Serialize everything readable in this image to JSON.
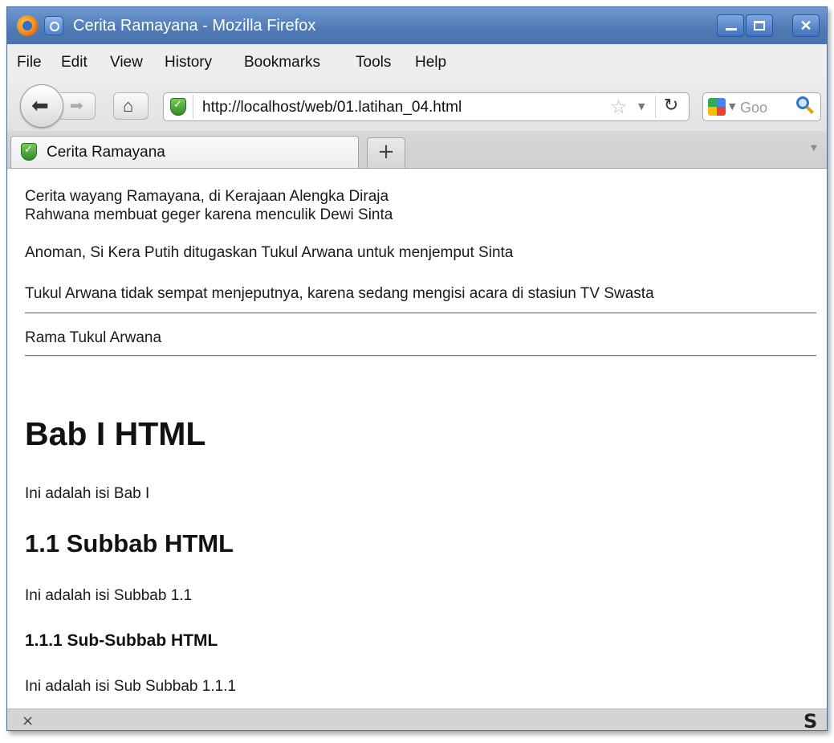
{
  "window": {
    "title": "Cerita Ramayana - Mozilla Firefox"
  },
  "menubar": {
    "items": [
      {
        "label": "File"
      },
      {
        "label": "Edit"
      },
      {
        "label": "View"
      },
      {
        "label": "History"
      },
      {
        "label": "Bookmarks"
      },
      {
        "label": "Tools"
      },
      {
        "label": "Help"
      }
    ]
  },
  "navbar": {
    "url": "http://localhost/web/01.latihan_04.html",
    "search_placeholder": "Goo"
  },
  "tabs": [
    {
      "label": "Cerita Ramayana",
      "active": true
    }
  ],
  "content": {
    "para1_line1": "Cerita wayang Ramayana, di Kerajaan Alengka Diraja",
    "para1_line2": "Rahwana membuat geger karena menculik Dewi Sinta",
    "para2": "Anoman, Si Kera Putih ditugaskan Tukul Arwana untuk menjemput Sinta",
    "para3": "Tukul Arwana tidak sempat menjeputnya, karena sedang mengisi acara di stasiun TV Swasta",
    "para4": "Rama Tukul Arwana",
    "h1": "Bab I HTML",
    "h1_body": "Ini adalah isi Bab I",
    "h2": "1.1 Subbab HTML",
    "h2_body": "Ini adalah isi Subbab 1.1",
    "h3": "1.1.1 Sub-Subbab HTML",
    "h3_body": "Ini adalah isi Sub Subbab 1.1.1"
  },
  "statusbar": {
    "close_glyph": "×",
    "addon_glyph": "S"
  },
  "icons": {
    "back": "back-arrow-icon",
    "forward": "forward-arrow-icon",
    "home": "home-icon",
    "site_identity": "shield-check-icon",
    "bookmark": "star-icon",
    "reload": "reload-icon",
    "search_engine": "google-icon",
    "search": "magnifier-icon"
  },
  "colors": {
    "titlebar": "#4f7ab6",
    "titlebar_text": "#ffffff",
    "menubar": "#eeeeee",
    "statusbar": "#d4d4d4"
  }
}
